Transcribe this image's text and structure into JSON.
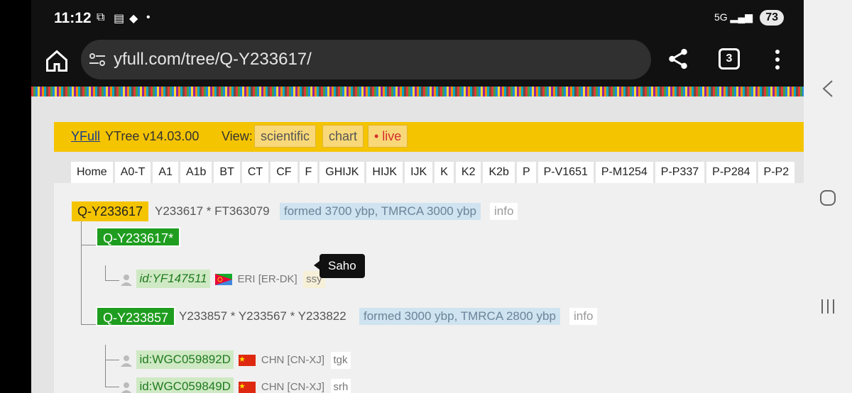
{
  "status": {
    "time": "11:12",
    "network": "5G",
    "battery": "73"
  },
  "browser": {
    "url": "yfull.com/tree/Q-Y233617/",
    "tab_count": "3"
  },
  "header": {
    "site": "YFull",
    "version": "YTree v14.03.00",
    "view_label": "View:",
    "views": [
      "scientific",
      "chart",
      "• live"
    ]
  },
  "nav": [
    "Home",
    "A0-T",
    "A1",
    "A1b",
    "BT",
    "CT",
    "CF",
    "F",
    "GHIJK",
    "HIJK",
    "IJK",
    "K",
    "K2",
    "K2b",
    "P",
    "P-V1651",
    "P-M1254",
    "P-P337",
    "P-P284",
    "P-P2"
  ],
  "tree": {
    "root": {
      "name": "Q-Y233617",
      "snps": "Y233617 * FT363079",
      "formed": "formed 3700 ybp, TMRCA 3000 ybp",
      "info": "info"
    },
    "child1": {
      "name": "Q-Y233617*",
      "sample": {
        "id": "id:YF147511",
        "country": "ERI [ER-DK]",
        "lang": "ssy"
      }
    },
    "child2": {
      "name": "Q-Y233857",
      "snps": "Y233857 * Y233567 * Y233822",
      "formed": "formed 3000 ybp, TMRCA 2800 ybp",
      "info": "info",
      "samples": [
        {
          "id": "id:WGC059892D",
          "country": "CHN [CN-XJ]",
          "lang": "tgk"
        },
        {
          "id": "id:WGC059849D",
          "country": "CHN [CN-XJ]",
          "lang": "srh"
        }
      ]
    },
    "tooltip": "Saho"
  }
}
